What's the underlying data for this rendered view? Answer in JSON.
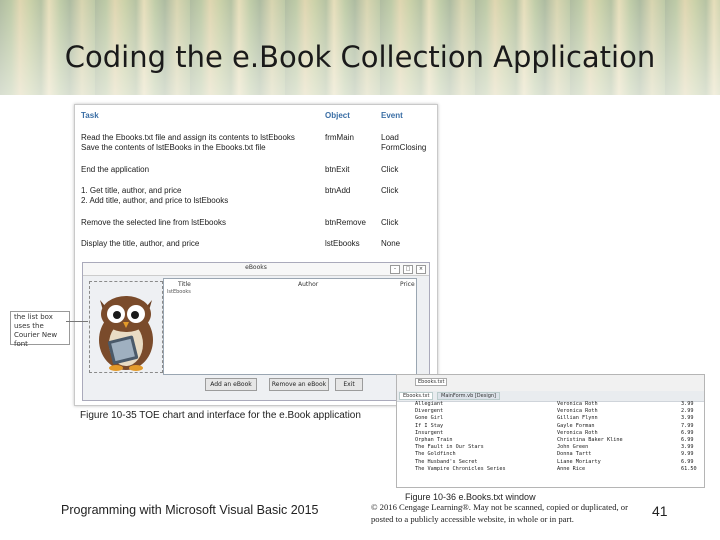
{
  "slide": {
    "title": "Coding the e.Book Collection Application",
    "footer_left": "Programming with Microsoft Visual Basic 2015",
    "page_number": "41",
    "copyright": "© 2016 Cengage Learning®. May not be scanned, copied or duplicated, or posted to a publicly accessible website, in whole or in part."
  },
  "toe_chart": {
    "headers": {
      "task": "Task",
      "object": "Object",
      "event": "Event"
    },
    "rows": [
      {
        "task1": "Read the Ebooks.txt file and assign its contents to lstEbooks",
        "task2": "Save the contents of lstEBooks in the Ebooks.txt file",
        "object": "frmMain",
        "event1": "Load",
        "event2": "FormClosing"
      },
      {
        "task1": "End the application",
        "task2": "",
        "object": "btnExit",
        "event1": "Click",
        "event2": ""
      },
      {
        "task1": "1. Get title, author, and price",
        "task2": "2. Add title, author, and price to lstEbooks",
        "object": "btnAdd",
        "event1": "Click",
        "event2": ""
      },
      {
        "task1": "Remove the selected line from lstEbooks",
        "task2": "",
        "object": "btnRemove",
        "event1": "Click",
        "event2": ""
      },
      {
        "task1": "Display the title, author, and price",
        "task2": "",
        "object": "lstEbooks",
        "event1": "None",
        "event2": ""
      }
    ]
  },
  "form": {
    "title": "eBooks",
    "col_title": "Title",
    "col_author": "Author",
    "col_price": "Price",
    "list_selected": "lstEbooks",
    "add_button": "Add an eBook",
    "remove_button": "Remove an eBook",
    "exit_button": "Exit",
    "callout": "the list box uses the Courier New font"
  },
  "caption_1": "Figure 10-35 TOE chart and interface for the e.Book application",
  "txt_window": {
    "tool_label": "Ebooks.txt",
    "tabs": [
      "Ebooks.txt",
      "MainForm.vb [Design]"
    ],
    "rows": [
      {
        "title": "Allegiant",
        "author": "Veronica Roth",
        "price": "3.99"
      },
      {
        "title": "Divergent",
        "author": "Veronica Roth",
        "price": "2.99"
      },
      {
        "title": "Gone Girl",
        "author": "Gillian Flynn",
        "price": "3.99"
      },
      {
        "title": "If I Stay",
        "author": "Gayle Forman",
        "price": "7.99"
      },
      {
        "title": "Insurgent",
        "author": "Veronica Roth",
        "price": "6.99"
      },
      {
        "title": "Orphan Train",
        "author": "Christina Baker Kline",
        "price": "6.99"
      },
      {
        "title": "The Fault in Our Stars",
        "author": "John Green",
        "price": "3.99"
      },
      {
        "title": "The Goldfinch",
        "author": "Donna Tartt",
        "price": "9.99"
      },
      {
        "title": "The Husband's Secret",
        "author": "Liane Moriarty",
        "price": "6.99"
      },
      {
        "title": "The Vampire Chronicles Series",
        "author": "Anne Rice",
        "price": "61.50"
      }
    ]
  },
  "caption_2": "Figure 10-36 e.Books.txt window"
}
